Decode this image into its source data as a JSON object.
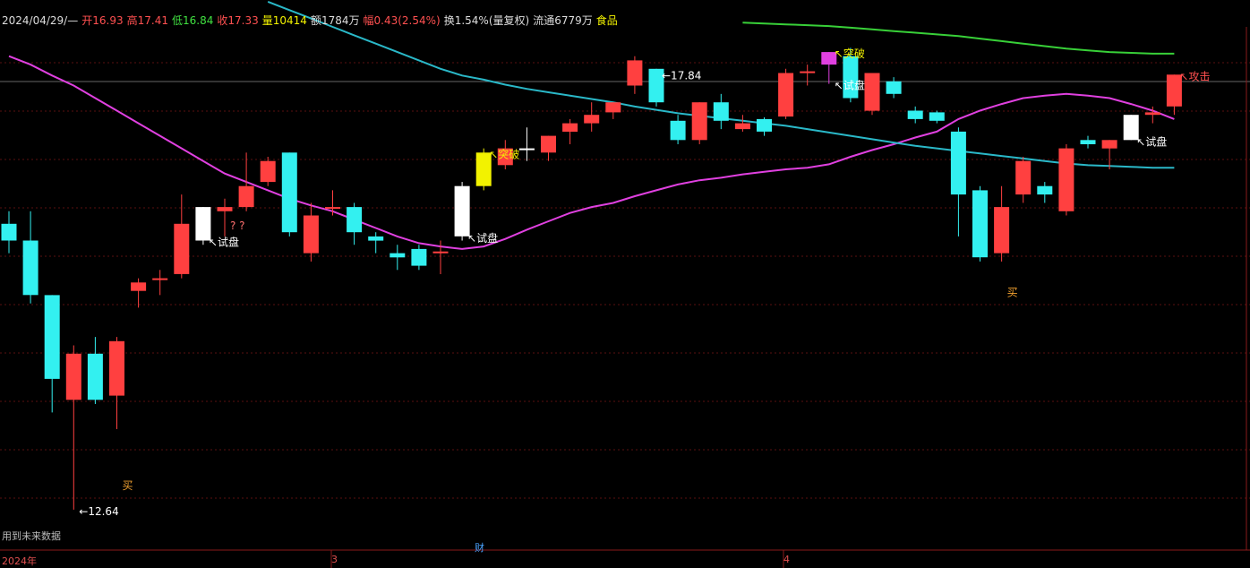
{
  "header": {
    "date": "2024/04/29/—",
    "open_label": "开",
    "open": "16.93",
    "high_label": "高",
    "high": "17.41",
    "low_label": "低",
    "low": "16.84",
    "close_label": "收",
    "close": "17.33",
    "vol_label": "量",
    "vol": "10414",
    "amount_label": "额",
    "amount": "1784万",
    "change_label": "幅",
    "change": "0.43(2.54%)",
    "turnover": "换1.54%(量复权)",
    "float_label": "流通",
    "float": "6779万",
    "sector": "食品"
  },
  "footer": {
    "note": "用到未来数据",
    "cai": "财",
    "x_labels": [
      "2024年",
      "3",
      "4"
    ]
  },
  "colors": {
    "up": "#ff4040",
    "down": "#33f0f0",
    "magenta": "#e040e0",
    "teal": "#2ab8c8",
    "green": "#38d038",
    "white": "#ffffff",
    "yellow": "#f2f200"
  },
  "chart_data": {
    "type": "candlestick",
    "price_range": [
      12.2,
      18.4
    ],
    "candles": [
      {
        "o": 16.05,
        "h": 16.2,
        "l": 15.7,
        "c": 15.85,
        "color": "down"
      },
      {
        "o": 15.85,
        "h": 16.2,
        "l": 15.1,
        "c": 15.2,
        "color": "down"
      },
      {
        "o": 15.2,
        "h": 15.2,
        "l": 13.8,
        "c": 14.2,
        "color": "down"
      },
      {
        "o": 13.95,
        "h": 14.6,
        "l": 12.64,
        "c": 14.5,
        "color": "up"
      },
      {
        "o": 14.5,
        "h": 14.7,
        "l": 13.9,
        "c": 13.95,
        "color": "down"
      },
      {
        "o": 14.0,
        "h": 14.7,
        "l": 13.6,
        "c": 14.65,
        "color": "up"
      },
      {
        "o": 15.25,
        "h": 15.4,
        "l": 15.05,
        "c": 15.35,
        "color": "up"
      },
      {
        "o": 15.38,
        "h": 15.5,
        "l": 15.2,
        "c": 15.4,
        "color": "up"
      },
      {
        "o": 15.45,
        "h": 16.4,
        "l": 15.4,
        "c": 16.05,
        "color": "up"
      },
      {
        "o": 15.85,
        "h": 16.25,
        "l": 15.8,
        "c": 16.25,
        "color": "white"
      },
      {
        "o": 16.2,
        "h": 16.35,
        "l": 15.9,
        "c": 16.25,
        "color": "up"
      },
      {
        "o": 16.25,
        "h": 16.9,
        "l": 16.2,
        "c": 16.5,
        "color": "up"
      },
      {
        "o": 16.55,
        "h": 16.85,
        "l": 16.5,
        "c": 16.8,
        "color": "up"
      },
      {
        "o": 16.9,
        "h": 16.9,
        "l": 15.9,
        "c": 15.95,
        "color": "down"
      },
      {
        "o": 15.7,
        "h": 16.3,
        "l": 15.6,
        "c": 16.15,
        "color": "up"
      },
      {
        "o": 16.25,
        "h": 16.45,
        "l": 16.15,
        "c": 16.25,
        "color": "up"
      },
      {
        "o": 16.25,
        "h": 16.3,
        "l": 15.8,
        "c": 15.95,
        "color": "down"
      },
      {
        "o": 15.9,
        "h": 15.95,
        "l": 15.7,
        "c": 15.85,
        "color": "down"
      },
      {
        "o": 15.7,
        "h": 15.8,
        "l": 15.5,
        "c": 15.65,
        "color": "down"
      },
      {
        "o": 15.75,
        "h": 15.8,
        "l": 15.5,
        "c": 15.55,
        "color": "down"
      },
      {
        "o": 15.72,
        "h": 15.85,
        "l": 15.45,
        "c": 15.72,
        "color": "up"
      },
      {
        "o": 15.9,
        "h": 16.55,
        "l": 15.85,
        "c": 16.5,
        "color": "white"
      },
      {
        "o": 16.5,
        "h": 16.95,
        "l": 16.45,
        "c": 16.9,
        "color": "yellow"
      },
      {
        "o": 16.75,
        "h": 17.05,
        "l": 16.7,
        "c": 16.95,
        "color": "up"
      },
      {
        "o": 16.95,
        "h": 17.2,
        "l": 16.8,
        "c": 16.95,
        "color": "white"
      },
      {
        "o": 16.9,
        "h": 17.1,
        "l": 16.8,
        "c": 17.1,
        "color": "up"
      },
      {
        "o": 17.15,
        "h": 17.3,
        "l": 17.0,
        "c": 17.25,
        "color": "up"
      },
      {
        "o": 17.25,
        "h": 17.5,
        "l": 17.15,
        "c": 17.35,
        "color": "up"
      },
      {
        "o": 17.38,
        "h": 17.5,
        "l": 17.3,
        "c": 17.5,
        "color": "up"
      },
      {
        "o": 17.7,
        "h": 18.05,
        "l": 17.6,
        "c": 18.0,
        "color": "up"
      },
      {
        "o": 17.9,
        "h": 17.84,
        "l": 17.45,
        "c": 17.5,
        "color": "down"
      },
      {
        "o": 17.28,
        "h": 17.35,
        "l": 17.0,
        "c": 17.05,
        "color": "down"
      },
      {
        "o": 17.05,
        "h": 17.5,
        "l": 17.0,
        "c": 17.5,
        "color": "up"
      },
      {
        "o": 17.5,
        "h": 17.6,
        "l": 17.18,
        "c": 17.28,
        "color": "down"
      },
      {
        "o": 17.18,
        "h": 17.35,
        "l": 17.15,
        "c": 17.25,
        "color": "up"
      },
      {
        "o": 17.15,
        "h": 17.32,
        "l": 17.1,
        "c": 17.3,
        "color": "down"
      },
      {
        "o": 17.33,
        "h": 17.9,
        "l": 17.3,
        "c": 17.85,
        "color": "up"
      },
      {
        "o": 17.85,
        "h": 17.95,
        "l": 17.7,
        "c": 17.87,
        "color": "up"
      },
      {
        "o": 17.95,
        "h": 18.0,
        "l": 17.72,
        "c": 18.1,
        "color": "magenta"
      },
      {
        "o": 18.05,
        "h": 18.15,
        "l": 17.5,
        "c": 17.55,
        "color": "down"
      },
      {
        "o": 17.4,
        "h": 17.85,
        "l": 17.35,
        "c": 17.85,
        "color": "up"
      },
      {
        "o": 17.75,
        "h": 17.8,
        "l": 17.55,
        "c": 17.6,
        "color": "down"
      },
      {
        "o": 17.4,
        "h": 17.45,
        "l": 17.25,
        "c": 17.3,
        "color": "down"
      },
      {
        "o": 17.38,
        "h": 17.4,
        "l": 17.25,
        "c": 17.28,
        "color": "down"
      },
      {
        "o": 17.15,
        "h": 17.2,
        "l": 15.9,
        "c": 16.4,
        "color": "down"
      },
      {
        "o": 16.45,
        "h": 16.5,
        "l": 15.6,
        "c": 15.65,
        "color": "down"
      },
      {
        "o": 15.7,
        "h": 16.5,
        "l": 15.6,
        "c": 16.25,
        "color": "up"
      },
      {
        "o": 16.4,
        "h": 16.85,
        "l": 16.3,
        "c": 16.8,
        "color": "up"
      },
      {
        "o": 16.4,
        "h": 16.55,
        "l": 16.3,
        "c": 16.5,
        "color": "down"
      },
      {
        "o": 16.2,
        "h": 17.0,
        "l": 16.15,
        "c": 16.95,
        "color": "up"
      },
      {
        "o": 17.0,
        "h": 17.1,
        "l": 16.95,
        "c": 17.05,
        "color": "down"
      },
      {
        "o": 16.95,
        "h": 17.05,
        "l": 16.7,
        "c": 17.05,
        "color": "up"
      },
      {
        "o": 17.05,
        "h": 17.35,
        "l": 17.05,
        "c": 17.35,
        "color": "white"
      },
      {
        "o": 17.35,
        "h": 17.45,
        "l": 17.25,
        "c": 17.38,
        "color": "up"
      },
      {
        "o": 17.45,
        "h": 17.83,
        "l": 17.35,
        "c": 17.83,
        "color": "up"
      }
    ],
    "series": [
      {
        "color": "magenta",
        "values": [
          18.05,
          17.95,
          17.82,
          17.7,
          17.55,
          17.4,
          17.25,
          17.1,
          16.95,
          16.8,
          16.65,
          16.55,
          16.45,
          16.35,
          16.27,
          16.2,
          16.1,
          16.0,
          15.9,
          15.82,
          15.78,
          15.75,
          15.78,
          15.87,
          15.98,
          16.08,
          16.18,
          16.25,
          16.3,
          16.38,
          16.45,
          16.52,
          16.57,
          16.6,
          16.64,
          16.67,
          16.7,
          16.72,
          16.76,
          16.85,
          16.93,
          17.0,
          17.08,
          17.15,
          17.3,
          17.4,
          17.48,
          17.55,
          17.58,
          17.6,
          17.58,
          17.55,
          17.48,
          17.4,
          17.3
        ]
      },
      {
        "color": "teal",
        "values": [
          null,
          null,
          null,
          null,
          null,
          null,
          null,
          null,
          null,
          null,
          null,
          null,
          18.7,
          18.6,
          18.5,
          18.4,
          18.3,
          18.2,
          18.1,
          18.0,
          17.9,
          17.82,
          17.77,
          17.71,
          17.66,
          17.62,
          17.58,
          17.54,
          17.5,
          17.45,
          17.41,
          17.37,
          17.34,
          17.31,
          17.28,
          17.25,
          17.22,
          17.18,
          17.14,
          17.1,
          17.06,
          17.02,
          16.98,
          16.95,
          16.92,
          16.89,
          16.86,
          16.83,
          16.8,
          16.77,
          16.75,
          16.74,
          16.73,
          16.72,
          16.72
        ]
      },
      {
        "color": "green",
        "values": [
          null,
          null,
          null,
          null,
          null,
          null,
          null,
          null,
          null,
          null,
          null,
          null,
          null,
          null,
          null,
          null,
          null,
          null,
          null,
          null,
          null,
          null,
          null,
          null,
          null,
          null,
          null,
          null,
          null,
          null,
          null,
          null,
          null,
          null,
          18.45,
          18.44,
          18.43,
          18.42,
          18.41,
          18.39,
          18.37,
          18.35,
          18.33,
          18.31,
          18.29,
          18.26,
          18.23,
          18.2,
          18.17,
          18.14,
          18.12,
          18.1,
          18.09,
          18.08,
          18.08
        ]
      }
    ],
    "annotations": [
      {
        "index": 3,
        "text": "12.64",
        "price": 12.64
      },
      {
        "index": 30,
        "text": "17.84",
        "price": 17.84
      },
      {
        "index": 9,
        "text": "试盘",
        "price": 15.85
      },
      {
        "index": 21,
        "text": "试盘",
        "price": 15.9
      },
      {
        "index": 38,
        "text": "试盘",
        "price": 17.72
      },
      {
        "index": 52,
        "text": "试盘",
        "price": 17.05
      },
      {
        "index": 22,
        "text": "突破",
        "price": 16.9
      },
      {
        "index": 38,
        "text": "突破",
        "price": 18.1
      },
      {
        "index": 5,
        "text": "买",
        "price": 12.95
      },
      {
        "index": 46,
        "text": "买",
        "price": 15.25
      },
      {
        "index": 54,
        "text": "攻击",
        "price": 17.83
      },
      {
        "index": 10,
        "text": "? ?",
        "price": 16.05
      }
    ]
  }
}
